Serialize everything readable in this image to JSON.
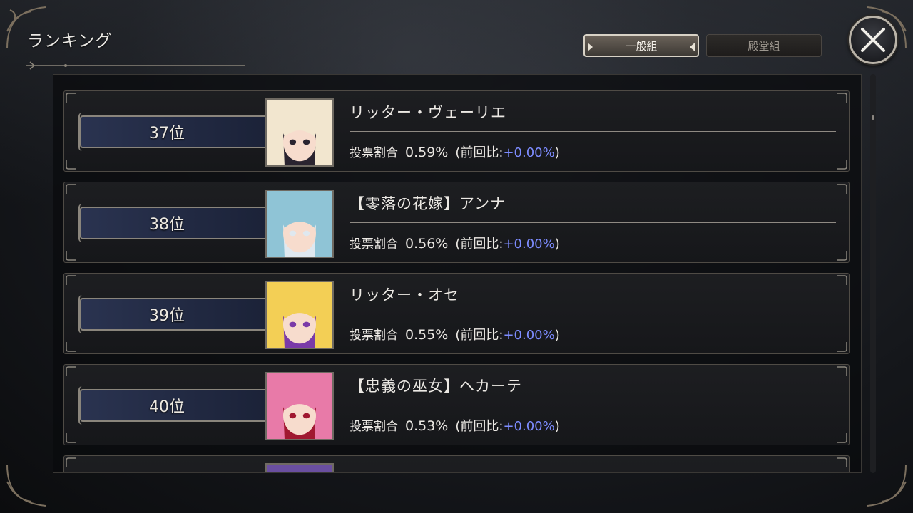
{
  "header": {
    "title": "ランキング"
  },
  "tabs": [
    {
      "label": "一般組",
      "active": true
    },
    {
      "label": "殿堂組",
      "active": false
    }
  ],
  "close_icon": "close-icon",
  "colors": {
    "delta": "#7d8cff",
    "rank_plate": "#2a3350",
    "active_tab": "#6a6259"
  },
  "ranking": [
    {
      "rank": "37位",
      "name": "リッター・ヴェーリエ",
      "vote_label": "投票割合",
      "vote_pct": "0.59%",
      "prev_open": "(前回比:",
      "prev_delta": "+0.00%",
      "prev_close": ")",
      "portrait_hair": "#f2e6cf",
      "portrait_accent": "#2a2430"
    },
    {
      "rank": "38位",
      "name": "【零落の花嫁】アンナ",
      "vote_label": "投票割合",
      "vote_pct": "0.56%",
      "prev_open": "(前回比:",
      "prev_delta": "+0.00%",
      "prev_close": ")",
      "portrait_hair": "#8fc4d6",
      "portrait_accent": "#dfe8ef"
    },
    {
      "rank": "39位",
      "name": "リッター・オセ",
      "vote_label": "投票割合",
      "vote_pct": "0.55%",
      "prev_open": "(前回比:",
      "prev_delta": "+0.00%",
      "prev_close": ")",
      "portrait_hair": "#f3cf55",
      "portrait_accent": "#7a3aa8"
    },
    {
      "rank": "40位",
      "name": "【忠義の巫女】ヘカーテ",
      "vote_label": "投票割合",
      "vote_pct": "0.53%",
      "prev_open": "(前回比:",
      "prev_delta": "+0.00%",
      "prev_close": ")",
      "portrait_hair": "#e87aa8",
      "portrait_accent": "#a01830"
    },
    {
      "rank": "",
      "name": "",
      "vote_label": "",
      "vote_pct": "",
      "prev_open": "",
      "prev_delta": "",
      "prev_close": "",
      "portrait_hair": "#6a4fa0",
      "portrait_accent": "#2a2040"
    }
  ]
}
